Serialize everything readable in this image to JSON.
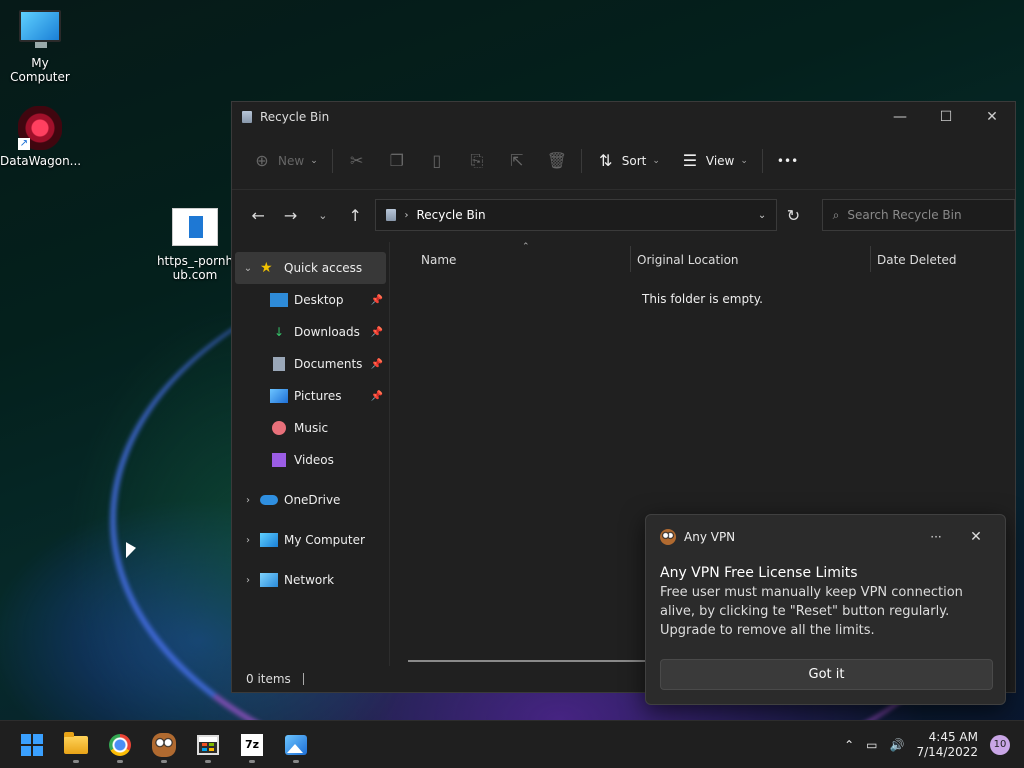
{
  "desktop": {
    "icons": [
      {
        "label": "My Computer"
      },
      {
        "label": "DataWagon..."
      },
      {
        "label_line1": "https_-pornh",
        "label_line2": "ub.com"
      }
    ]
  },
  "window": {
    "title": "Recycle Bin",
    "controls": {
      "minimize": "—",
      "maximize": "☐",
      "close": "✕"
    },
    "toolbar": {
      "new_label": "New",
      "sort_label": "Sort",
      "view_label": "View",
      "more_label": "•••"
    },
    "address": {
      "path": "Recycle Bin"
    },
    "search": {
      "placeholder": "Search Recycle Bin"
    },
    "sidebar": {
      "quick_access": "Quick access",
      "items": [
        {
          "label": "Desktop"
        },
        {
          "label": "Downloads"
        },
        {
          "label": "Documents"
        },
        {
          "label": "Pictures"
        },
        {
          "label": "Music"
        },
        {
          "label": "Videos"
        }
      ],
      "onedrive": "OneDrive",
      "my_computer": "My Computer",
      "network": "Network"
    },
    "columns": [
      "Name",
      "Original Location",
      "Date Deleted"
    ],
    "empty_message": "This folder is empty.",
    "status": "0 items"
  },
  "notification": {
    "app": "Any VPN",
    "more": "···",
    "close": "✕",
    "title": "Any VPN Free License Limits",
    "body": "Free user must manually keep VPN connection alive, by clicking te \"Reset\" button regularly. Upgrade to remove all the limits.",
    "button": "Got it"
  },
  "taskbar": {
    "seven_zip": "7z",
    "time": "4:45 AM",
    "date": "7/14/2022",
    "badge": "10"
  }
}
